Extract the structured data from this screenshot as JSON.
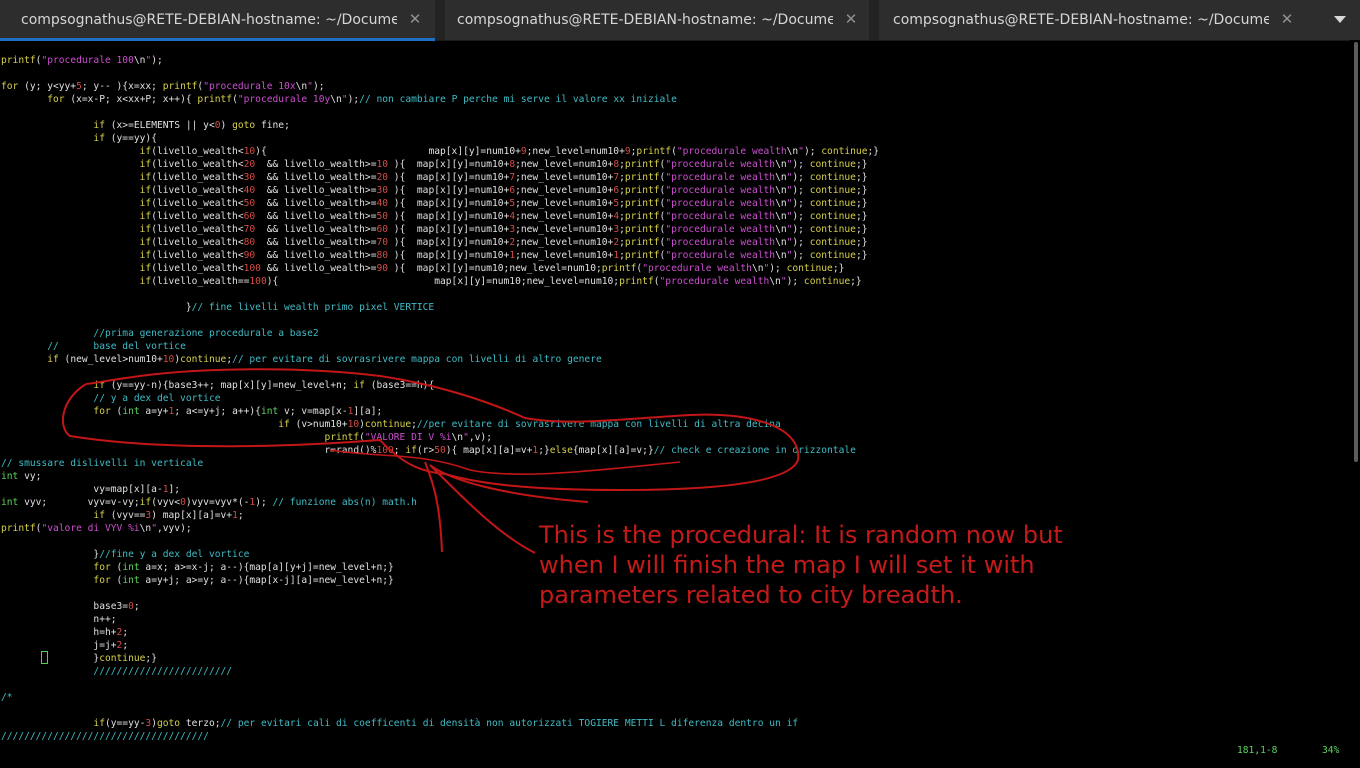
{
  "tabs": [
    {
      "title": "compsognathus@RETE-DEBIAN-hostname: ~/Docume…",
      "active": true
    },
    {
      "title": "compsognathus@RETE-DEBIAN-hostname: ~/Docume…",
      "active": false
    },
    {
      "title": "compsognathus@RETE-DEBIAN-hostname: ~/Docume…",
      "active": false
    }
  ],
  "colors": {
    "keyword": "#d7d04a",
    "comment": "#3fbcc6",
    "string": "#cc4fd0",
    "number": "#d44a44",
    "text": "#e0e0e0",
    "green": "#5ed35e",
    "annotation": "#c41a1a"
  },
  "code": [
    [
      [
        "y",
        "printf"
      ],
      [
        "w",
        "("
      ],
      [
        "m",
        "\"procedurale 100"
      ],
      [
        "w",
        "\\n"
      ],
      [
        "m",
        "\""
      ],
      [
        "w",
        ");"
      ]
    ],
    [],
    [
      [
        "y",
        "for"
      ],
      [
        "w",
        " (y; y<yy+"
      ],
      [
        "r",
        "5"
      ],
      [
        "w",
        "; y-- ){x=xx; "
      ],
      [
        "y",
        "printf"
      ],
      [
        "w",
        "("
      ],
      [
        "m",
        "\"procedurale 10x"
      ],
      [
        "w",
        "\\n"
      ],
      [
        "m",
        "\""
      ],
      [
        "w",
        ");"
      ]
    ],
    [
      [
        "w",
        "        "
      ],
      [
        "y",
        "for"
      ],
      [
        "w",
        " (x=x-P; x<xx+P; x++){ "
      ],
      [
        "y",
        "printf"
      ],
      [
        "w",
        "("
      ],
      [
        "m",
        "\"procedurale 10y"
      ],
      [
        "w",
        "\\n"
      ],
      [
        "m",
        "\""
      ],
      [
        "w",
        ");"
      ],
      [
        "c",
        "// non cambiare P perche mi serve il valore xx iniziale"
      ]
    ],
    [],
    [
      [
        "w",
        "                "
      ],
      [
        "y",
        "if"
      ],
      [
        "w",
        " (x>=ELEMENTS || y<"
      ],
      [
        "r",
        "0"
      ],
      [
        "w",
        ") "
      ],
      [
        "y",
        "goto"
      ],
      [
        "w",
        " fine;"
      ]
    ],
    [
      [
        "w",
        "                "
      ],
      [
        "y",
        "if"
      ],
      [
        "w",
        " (y==yy){"
      ]
    ],
    [
      [
        "w",
        "                        "
      ],
      [
        "y",
        "if"
      ],
      [
        "w",
        "(livello_wealth<"
      ],
      [
        "r",
        "10"
      ],
      [
        "w",
        "){                            map[x][y]=num10+"
      ],
      [
        "r",
        "9"
      ],
      [
        "w",
        ";new_level=num10+"
      ],
      [
        "r",
        "9"
      ],
      [
        "w",
        ";"
      ],
      [
        "y",
        "printf"
      ],
      [
        "w",
        "("
      ],
      [
        "m",
        "\"procedurale wealth"
      ],
      [
        "w",
        "\\n"
      ],
      [
        "m",
        "\""
      ],
      [
        "w",
        "); "
      ],
      [
        "y",
        "continue"
      ],
      [
        "w",
        ";}"
      ]
    ],
    [
      [
        "w",
        "                        "
      ],
      [
        "y",
        "if"
      ],
      [
        "w",
        "(livello_wealth<"
      ],
      [
        "r",
        "20"
      ],
      [
        "w",
        "  && livello_wealth>="
      ],
      [
        "r",
        "10"
      ],
      [
        "w",
        " ){  map[x][y]=num10+"
      ],
      [
        "r",
        "8"
      ],
      [
        "w",
        ";new_level=num10+"
      ],
      [
        "r",
        "8"
      ],
      [
        "w",
        ";"
      ],
      [
        "y",
        "printf"
      ],
      [
        "w",
        "("
      ],
      [
        "m",
        "\"procedurale wealth"
      ],
      [
        "w",
        "\\n"
      ],
      [
        "m",
        "\""
      ],
      [
        "w",
        "); "
      ],
      [
        "y",
        "continue"
      ],
      [
        "w",
        ";}"
      ]
    ],
    [
      [
        "w",
        "                        "
      ],
      [
        "y",
        "if"
      ],
      [
        "w",
        "(livello_wealth<"
      ],
      [
        "r",
        "30"
      ],
      [
        "w",
        "  && livello_wealth>="
      ],
      [
        "r",
        "20"
      ],
      [
        "w",
        " ){  map[x][y]=num10+"
      ],
      [
        "r",
        "7"
      ],
      [
        "w",
        ";new_level=num10+"
      ],
      [
        "r",
        "7"
      ],
      [
        "w",
        ";"
      ],
      [
        "y",
        "printf"
      ],
      [
        "w",
        "("
      ],
      [
        "m",
        "\"procedurale wealth"
      ],
      [
        "w",
        "\\n"
      ],
      [
        "m",
        "\""
      ],
      [
        "w",
        "); "
      ],
      [
        "y",
        "continue"
      ],
      [
        "w",
        ";}"
      ]
    ],
    [
      [
        "w",
        "                        "
      ],
      [
        "y",
        "if"
      ],
      [
        "w",
        "(livello_wealth<"
      ],
      [
        "r",
        "40"
      ],
      [
        "w",
        "  && livello_wealth>="
      ],
      [
        "r",
        "30"
      ],
      [
        "w",
        " ){  map[x][y]=num10+"
      ],
      [
        "r",
        "6"
      ],
      [
        "w",
        ";new_level=num10+"
      ],
      [
        "r",
        "6"
      ],
      [
        "w",
        ";"
      ],
      [
        "y",
        "printf"
      ],
      [
        "w",
        "("
      ],
      [
        "m",
        "\"procedurale wealth"
      ],
      [
        "w",
        "\\n"
      ],
      [
        "m",
        "\""
      ],
      [
        "w",
        "); "
      ],
      [
        "y",
        "continue"
      ],
      [
        "w",
        ";}"
      ]
    ],
    [
      [
        "w",
        "                        "
      ],
      [
        "y",
        "if"
      ],
      [
        "w",
        "(livello_wealth<"
      ],
      [
        "r",
        "50"
      ],
      [
        "w",
        "  && livello_wealth>="
      ],
      [
        "r",
        "40"
      ],
      [
        "w",
        " ){  map[x][y]=num10+"
      ],
      [
        "r",
        "5"
      ],
      [
        "w",
        ";new_level=num10+"
      ],
      [
        "r",
        "5"
      ],
      [
        "w",
        ";"
      ],
      [
        "y",
        "printf"
      ],
      [
        "w",
        "("
      ],
      [
        "m",
        "\"procedurale wealth"
      ],
      [
        "w",
        "\\n"
      ],
      [
        "m",
        "\""
      ],
      [
        "w",
        "); "
      ],
      [
        "y",
        "continue"
      ],
      [
        "w",
        ";}"
      ]
    ],
    [
      [
        "w",
        "                        "
      ],
      [
        "y",
        "if"
      ],
      [
        "w",
        "(livello_wealth<"
      ],
      [
        "r",
        "60"
      ],
      [
        "w",
        "  && livello_wealth>="
      ],
      [
        "r",
        "50"
      ],
      [
        "w",
        " ){  map[x][y]=num10+"
      ],
      [
        "r",
        "4"
      ],
      [
        "w",
        ";new_level=num10+"
      ],
      [
        "r",
        "4"
      ],
      [
        "w",
        ";"
      ],
      [
        "y",
        "printf"
      ],
      [
        "w",
        "("
      ],
      [
        "m",
        "\"procedurale wealth"
      ],
      [
        "w",
        "\\n"
      ],
      [
        "m",
        "\""
      ],
      [
        "w",
        "); "
      ],
      [
        "y",
        "continue"
      ],
      [
        "w",
        ";}"
      ]
    ],
    [
      [
        "w",
        "                        "
      ],
      [
        "y",
        "if"
      ],
      [
        "w",
        "(livello_wealth<"
      ],
      [
        "r",
        "70"
      ],
      [
        "w",
        "  && livello_wealth>="
      ],
      [
        "r",
        "60"
      ],
      [
        "w",
        " ){  map[x][y]=num10+"
      ],
      [
        "r",
        "3"
      ],
      [
        "w",
        ";new_level=num10+"
      ],
      [
        "r",
        "3"
      ],
      [
        "w",
        ";"
      ],
      [
        "y",
        "printf"
      ],
      [
        "w",
        "("
      ],
      [
        "m",
        "\"procedurale wealth"
      ],
      [
        "w",
        "\\n"
      ],
      [
        "m",
        "\""
      ],
      [
        "w",
        "); "
      ],
      [
        "y",
        "continue"
      ],
      [
        "w",
        ";}"
      ]
    ],
    [
      [
        "w",
        "                        "
      ],
      [
        "y",
        "if"
      ],
      [
        "w",
        "(livello_wealth<"
      ],
      [
        "r",
        "80"
      ],
      [
        "w",
        "  && livello_wealth>="
      ],
      [
        "r",
        "70"
      ],
      [
        "w",
        " ){  map[x][y]=num10+"
      ],
      [
        "r",
        "2"
      ],
      [
        "w",
        ";new_level=num10+"
      ],
      [
        "r",
        "2"
      ],
      [
        "w",
        ";"
      ],
      [
        "y",
        "printf"
      ],
      [
        "w",
        "("
      ],
      [
        "m",
        "\"procedurale wealth"
      ],
      [
        "w",
        "\\n"
      ],
      [
        "m",
        "\""
      ],
      [
        "w",
        "); "
      ],
      [
        "y",
        "continue"
      ],
      [
        "w",
        ";}"
      ]
    ],
    [
      [
        "w",
        "                        "
      ],
      [
        "y",
        "if"
      ],
      [
        "w",
        "(livello_wealth<"
      ],
      [
        "r",
        "90"
      ],
      [
        "w",
        "  && livello_wealth>="
      ],
      [
        "r",
        "80"
      ],
      [
        "w",
        " ){  map[x][y]=num10+"
      ],
      [
        "r",
        "1"
      ],
      [
        "w",
        ";new_level=num10+"
      ],
      [
        "r",
        "1"
      ],
      [
        "w",
        ";"
      ],
      [
        "y",
        "printf"
      ],
      [
        "w",
        "("
      ],
      [
        "m",
        "\"procedurale wealth"
      ],
      [
        "w",
        "\\n"
      ],
      [
        "m",
        "\""
      ],
      [
        "w",
        "); "
      ],
      [
        "y",
        "continue"
      ],
      [
        "w",
        ";}"
      ]
    ],
    [
      [
        "w",
        "                        "
      ],
      [
        "y",
        "if"
      ],
      [
        "w",
        "(livello_wealth<"
      ],
      [
        "r",
        "100"
      ],
      [
        "w",
        " && livello_wealth>="
      ],
      [
        "r",
        "90"
      ],
      [
        "w",
        " ){  map[x][y]=num10;new_level=num10;"
      ],
      [
        "y",
        "printf"
      ],
      [
        "w",
        "("
      ],
      [
        "m",
        "\"procedurale wealth"
      ],
      [
        "w",
        "\\n"
      ],
      [
        "m",
        "\""
      ],
      [
        "w",
        "); "
      ],
      [
        "y",
        "continue"
      ],
      [
        "w",
        ";}"
      ]
    ],
    [
      [
        "w",
        "                        "
      ],
      [
        "y",
        "if"
      ],
      [
        "w",
        "(livello_wealth=="
      ],
      [
        "r",
        "100"
      ],
      [
        "w",
        "){                           map[x][y]=num10;new_level=num10;"
      ],
      [
        "y",
        "printf"
      ],
      [
        "w",
        "("
      ],
      [
        "m",
        "\"procedurale wealth"
      ],
      [
        "w",
        "\\n"
      ],
      [
        "m",
        "\""
      ],
      [
        "w",
        "); "
      ],
      [
        "y",
        "continue"
      ],
      [
        "w",
        ";}"
      ]
    ],
    [],
    [
      [
        "w",
        "                                }"
      ],
      [
        "c",
        "// fine livelli wealth primo pixel VERTICE"
      ]
    ],
    [],
    [
      [
        "w",
        "                "
      ],
      [
        "c",
        "//prima generazione procedurale a base2"
      ]
    ],
    [
      [
        "w",
        "        "
      ],
      [
        "c",
        "//      base del vortice"
      ]
    ],
    [
      [
        "w",
        "        "
      ],
      [
        "y",
        "if"
      ],
      [
        "w",
        " (new_level>num10+"
      ],
      [
        "r",
        "10"
      ],
      [
        "w",
        ")"
      ],
      [
        "y",
        "continue"
      ],
      [
        "w",
        ";"
      ],
      [
        "c",
        "// per evitare di sovrasrivere mappa con livelli di altro genere"
      ]
    ],
    [],
    [
      [
        "w",
        "                "
      ],
      [
        "y",
        "if"
      ],
      [
        "w",
        " (y==yy-n){base3++; map[x][y]=new_level+n; "
      ],
      [
        "y",
        "if"
      ],
      [
        "w",
        " (base3==h){"
      ]
    ],
    [
      [
        "w",
        "                "
      ],
      [
        "c",
        "// y a dex del vortice"
      ]
    ],
    [
      [
        "w",
        "                "
      ],
      [
        "y",
        "for"
      ],
      [
        "w",
        " ("
      ],
      [
        "g",
        "int"
      ],
      [
        "w",
        " a=y+"
      ],
      [
        "r",
        "1"
      ],
      [
        "w",
        "; a<=y+j; a++){"
      ],
      [
        "g",
        "int"
      ],
      [
        "w",
        " v; v=map[x-"
      ],
      [
        "r",
        "1"
      ],
      [
        "w",
        "][a];"
      ]
    ],
    [
      [
        "w",
        "                                                "
      ],
      [
        "y",
        "if"
      ],
      [
        "w",
        " (v>num10+"
      ],
      [
        "r",
        "10"
      ],
      [
        "w",
        ")"
      ],
      [
        "y",
        "continue"
      ],
      [
        "w",
        ";"
      ],
      [
        "c",
        "//per evitare di sovrasrivere mappa con livelli di altra decina"
      ]
    ],
    [
      [
        "w",
        "                                                        "
      ],
      [
        "y",
        "printf"
      ],
      [
        "w",
        "("
      ],
      [
        "m",
        "\"VALORE DI V %i"
      ],
      [
        "w",
        "\\n"
      ],
      [
        "m",
        "\""
      ],
      [
        "w",
        ",v);"
      ]
    ],
    [
      [
        "w",
        "                                                        r=rand()%"
      ],
      [
        "r",
        "100"
      ],
      [
        "w",
        "; "
      ],
      [
        "y",
        "if"
      ],
      [
        "w",
        "(r>"
      ],
      [
        "r",
        "50"
      ],
      [
        "w",
        "){ map[x][a]=v+"
      ],
      [
        "r",
        "1"
      ],
      [
        "w",
        ";}"
      ],
      [
        "y",
        "else"
      ],
      [
        "w",
        "{map[x][a]=v;}"
      ],
      [
        "c",
        "// check e creazione in orizzontale"
      ]
    ],
    [
      [
        "c",
        "// smussare dislivelli in verticale"
      ]
    ],
    [
      [
        "g",
        "int"
      ],
      [
        "w",
        " vy;"
      ]
    ],
    [
      [
        "w",
        "                vy=map[x][a-"
      ],
      [
        "r",
        "1"
      ],
      [
        "w",
        "];"
      ]
    ],
    [
      [
        "g",
        "int"
      ],
      [
        "w",
        " vyv;       vyv=v-vy;"
      ],
      [
        "y",
        "if"
      ],
      [
        "w",
        "(vyv<"
      ],
      [
        "r",
        "0"
      ],
      [
        "w",
        ")vyv=vyv*(-"
      ],
      [
        "r",
        "1"
      ],
      [
        "w",
        "); "
      ],
      [
        "c",
        "// funzione abs(n) math.h"
      ]
    ],
    [
      [
        "w",
        "                "
      ],
      [
        "y",
        "if"
      ],
      [
        "w",
        " (vyv=="
      ],
      [
        "r",
        "3"
      ],
      [
        "w",
        ") map[x][a]=v+"
      ],
      [
        "r",
        "1"
      ],
      [
        "w",
        ";"
      ]
    ],
    [
      [
        "y",
        "printf"
      ],
      [
        "w",
        "("
      ],
      [
        "m",
        "\"valore di VYV %i"
      ],
      [
        "w",
        "\\n"
      ],
      [
        "m",
        "\""
      ],
      [
        "w",
        ",vyv);"
      ]
    ],
    [],
    [
      [
        "w",
        "                }"
      ],
      [
        "c",
        "//fine y a dex del vortice"
      ]
    ],
    [
      [
        "w",
        "                "
      ],
      [
        "y",
        "for"
      ],
      [
        "w",
        " ("
      ],
      [
        "g",
        "int"
      ],
      [
        "w",
        " a=x; a>=x-j; a--){map[a][y+j]=new_level+n;}"
      ]
    ],
    [
      [
        "w",
        "                "
      ],
      [
        "y",
        "for"
      ],
      [
        "w",
        " ("
      ],
      [
        "g",
        "int"
      ],
      [
        "w",
        " a=y+j; a>=y; a--){map[x-j][a]=new_level+n;}"
      ]
    ],
    [],
    [
      [
        "w",
        "                base3="
      ],
      [
        "r",
        "0"
      ],
      [
        "w",
        ";"
      ]
    ],
    [
      [
        "w",
        "                n++;"
      ]
    ],
    [
      [
        "w",
        "                h=h+"
      ],
      [
        "r",
        "2"
      ],
      [
        "w",
        ";"
      ]
    ],
    [
      [
        "w",
        "                j=j+"
      ],
      [
        "r",
        "2"
      ],
      [
        "w",
        ";"
      ]
    ],
    [
      [
        "w",
        "                }"
      ],
      [
        "y",
        "continue"
      ],
      [
        "w",
        ";}"
      ]
    ],
    [
      [
        "w",
        "                "
      ],
      [
        "c",
        "////////////////////////"
      ]
    ],
    [],
    [
      [
        "c",
        "/*"
      ]
    ],
    [],
    [
      [
        "w",
        "                "
      ],
      [
        "y",
        "if"
      ],
      [
        "w",
        "(y==yy-"
      ],
      [
        "r",
        "3"
      ],
      [
        "w",
        ")"
      ],
      [
        "y",
        "goto"
      ],
      [
        "w",
        " terzo;"
      ],
      [
        "c",
        "// per evitari cali di coefficenti di densità non autorizzati TOGIERE METTI L diferenza dentro un if"
      ]
    ],
    [
      [
        "c",
        "////////////////////////////////////"
      ]
    ]
  ],
  "status": {
    "position": "181,1-8",
    "percent": "34%"
  },
  "annotation": {
    "line1": "This is the procedural: It is random now but",
    "line2": "when I will finish the map I will set it with",
    "line3": "parameters related to city breadth."
  }
}
